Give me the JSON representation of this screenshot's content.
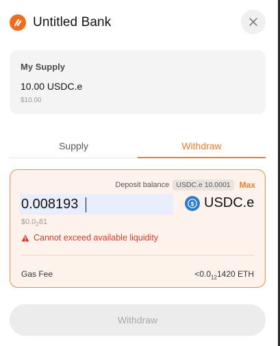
{
  "header": {
    "title": "Untitled Bank",
    "logo_color": "#f26c1f"
  },
  "supply_card": {
    "label": "My Supply",
    "amount": "10.00 USDC.e",
    "usd": "$10.00"
  },
  "tabs": [
    {
      "label": "Supply",
      "active": false
    },
    {
      "label": "Withdraw",
      "active": true
    }
  ],
  "withdraw": {
    "deposit_label": "Deposit balance",
    "deposit_value": "USDC.e 10.0001",
    "max_label": "Max",
    "amount": "0.008193",
    "token": "USDC.e",
    "usd_prefix": "$0.0",
    "usd_sub": "2",
    "usd_suffix": "81",
    "error": "Cannot exceed available liquidity",
    "gas_label": "Gas Fee",
    "gas_prefix": "<0.0",
    "gas_sub": "12",
    "gas_suffix": "1420 ETH"
  },
  "submit": {
    "label": "Withdraw"
  },
  "colors": {
    "accent": "#f07a2a",
    "error": "#d8392b",
    "token": "#2e7bcf"
  }
}
